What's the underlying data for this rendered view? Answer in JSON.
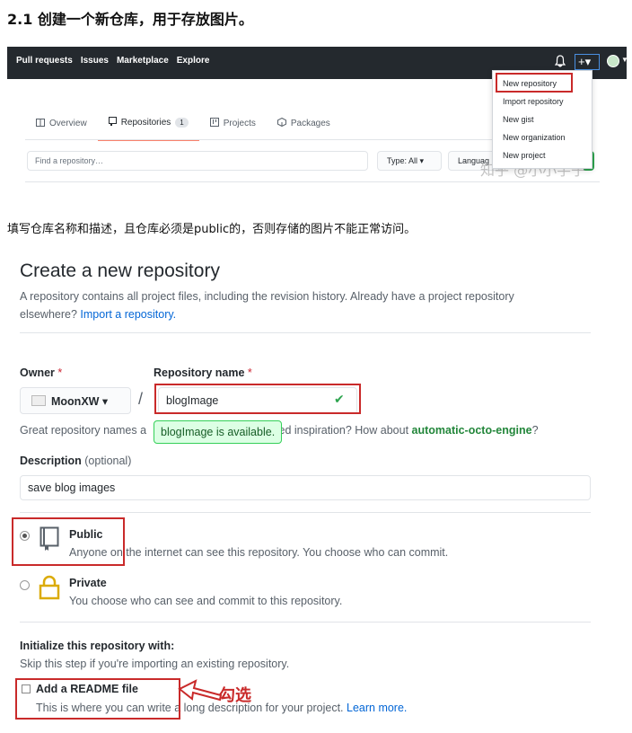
{
  "doc": {
    "heading": "2.1 创建一个新仓库，用于存放图片。",
    "paragraph": "填写仓库名称和描述，且仓库必须是public的，否则存储的图片不能正常访问。",
    "watermark": "知乎 @小小芋子"
  },
  "github_header": {
    "nav": [
      "Pull requests",
      "Issues",
      "Marketplace",
      "Explore"
    ],
    "plus_label": "+▾",
    "dropdown": [
      "New repository",
      "Import repository",
      "New gist",
      "New organization",
      "New project"
    ]
  },
  "repo_nav": {
    "tabs": [
      {
        "label": "Overview",
        "icon": "book-icon"
      },
      {
        "label": "Repositories",
        "icon": "repo-icon",
        "count": "1"
      },
      {
        "label": "Projects",
        "icon": "project-icon"
      },
      {
        "label": "Packages",
        "icon": "package-icon"
      }
    ],
    "find_placeholder": "Find a repository…",
    "type_label": "Type: All ▾",
    "language_label": "Languag"
  },
  "create": {
    "title": "Create a new repository",
    "desc_part1": "A repository contains all project files, including the revision history. Already have a project repository elsewhere? ",
    "import_link": "Import a repository.",
    "owner_label": "Owner",
    "repo_name_label": "Repository name",
    "required_mark": "*",
    "owner_value": "MoonXW ▾",
    "slash": "/",
    "repo_name_value": "blogImage",
    "check_mark": "✔",
    "great_prefix": "Great repository names a",
    "great_suffix": " Need inspiration? How about ",
    "suggestion": "automatic-octo-engine",
    "suggestion_end": "?",
    "available": "blogImage is available.",
    "description_label": "Description",
    "optional": "(optional)",
    "description_value": "save blog images",
    "public_title": "Public",
    "public_desc": "Anyone on the internet can see this repository. You choose who can commit.",
    "private_title": "Private",
    "private_desc": "You choose who can see and commit to this repository.",
    "init_title": "Initialize this repository with:",
    "skip_text": "Skip this step if you're importing an existing repository.",
    "readme_title": "Add a README file",
    "readme_desc": "This is where you can write a long description for your project. ",
    "learn_more": "Learn more.",
    "annotation": "勾选"
  },
  "colors": {
    "header_bg": "#24292e",
    "highlight_red": "#c92a2a",
    "link_blue": "#0366d6",
    "success_green": "#2ea44f"
  }
}
